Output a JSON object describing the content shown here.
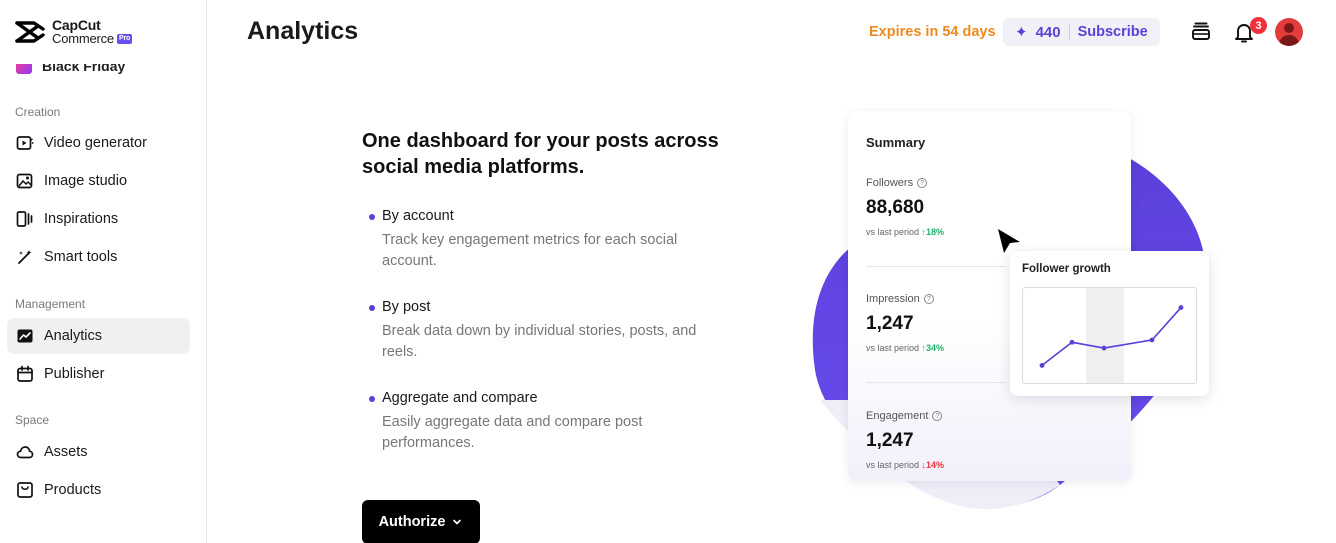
{
  "brand": {
    "name_line1": "CapCut",
    "name_line2": "Commerce",
    "badge": "Pro"
  },
  "sidebar": {
    "partial_item": "Black Friday",
    "sections": [
      {
        "label": "Creation",
        "items": [
          {
            "label": "Video generator",
            "icon": "video-play-icon"
          },
          {
            "label": "Image studio",
            "icon": "image-sparkle-icon"
          },
          {
            "label": "Inspirations",
            "icon": "inspirations-icon"
          },
          {
            "label": "Smart tools",
            "icon": "magic-wand-icon"
          }
        ]
      },
      {
        "label": "Management",
        "items": [
          {
            "label": "Analytics",
            "icon": "analytics-chart-icon",
            "active": true
          },
          {
            "label": "Publisher",
            "icon": "calendar-icon"
          }
        ]
      },
      {
        "label": "Space",
        "items": [
          {
            "label": "Assets",
            "icon": "cloud-icon"
          },
          {
            "label": "Products",
            "icon": "bag-icon"
          }
        ]
      }
    ]
  },
  "header": {
    "title": "Analytics",
    "expires": "Expires in 54 days",
    "credits": "440",
    "subscribe": "Subscribe",
    "notification_count": "3"
  },
  "main": {
    "headline": "One dashboard for your posts across social media platforms.",
    "features": [
      {
        "title": "By account",
        "desc": "Track key engagement metrics for each social account."
      },
      {
        "title": "By post",
        "desc": "Break data down by individual stories, posts, and reels."
      },
      {
        "title": "Aggregate and compare",
        "desc": "Easily aggregate data and compare post performances."
      }
    ],
    "authorize": "Authorize"
  },
  "illustration": {
    "summary_title": "Summary",
    "metrics": [
      {
        "label": "Followers",
        "value": "88,680",
        "compare": "vs last period",
        "change": "↑18%",
        "trend": "up"
      },
      {
        "label": "Impression",
        "value": "1,247",
        "compare": "vs last period",
        "change": "↑34%",
        "trend": "up"
      },
      {
        "label": "Engagement",
        "value": "1,247",
        "compare": "vs last period",
        "change": "↓14%",
        "trend": "down"
      }
    ],
    "growth_title": "Follower growth",
    "growth_points": [
      1,
      3,
      2.5,
      3.2,
      6
    ],
    "colors": {
      "accent": "#5b3fd9",
      "up": "#1db36a",
      "down": "#f0313b",
      "expires": "#f08a1e"
    }
  }
}
